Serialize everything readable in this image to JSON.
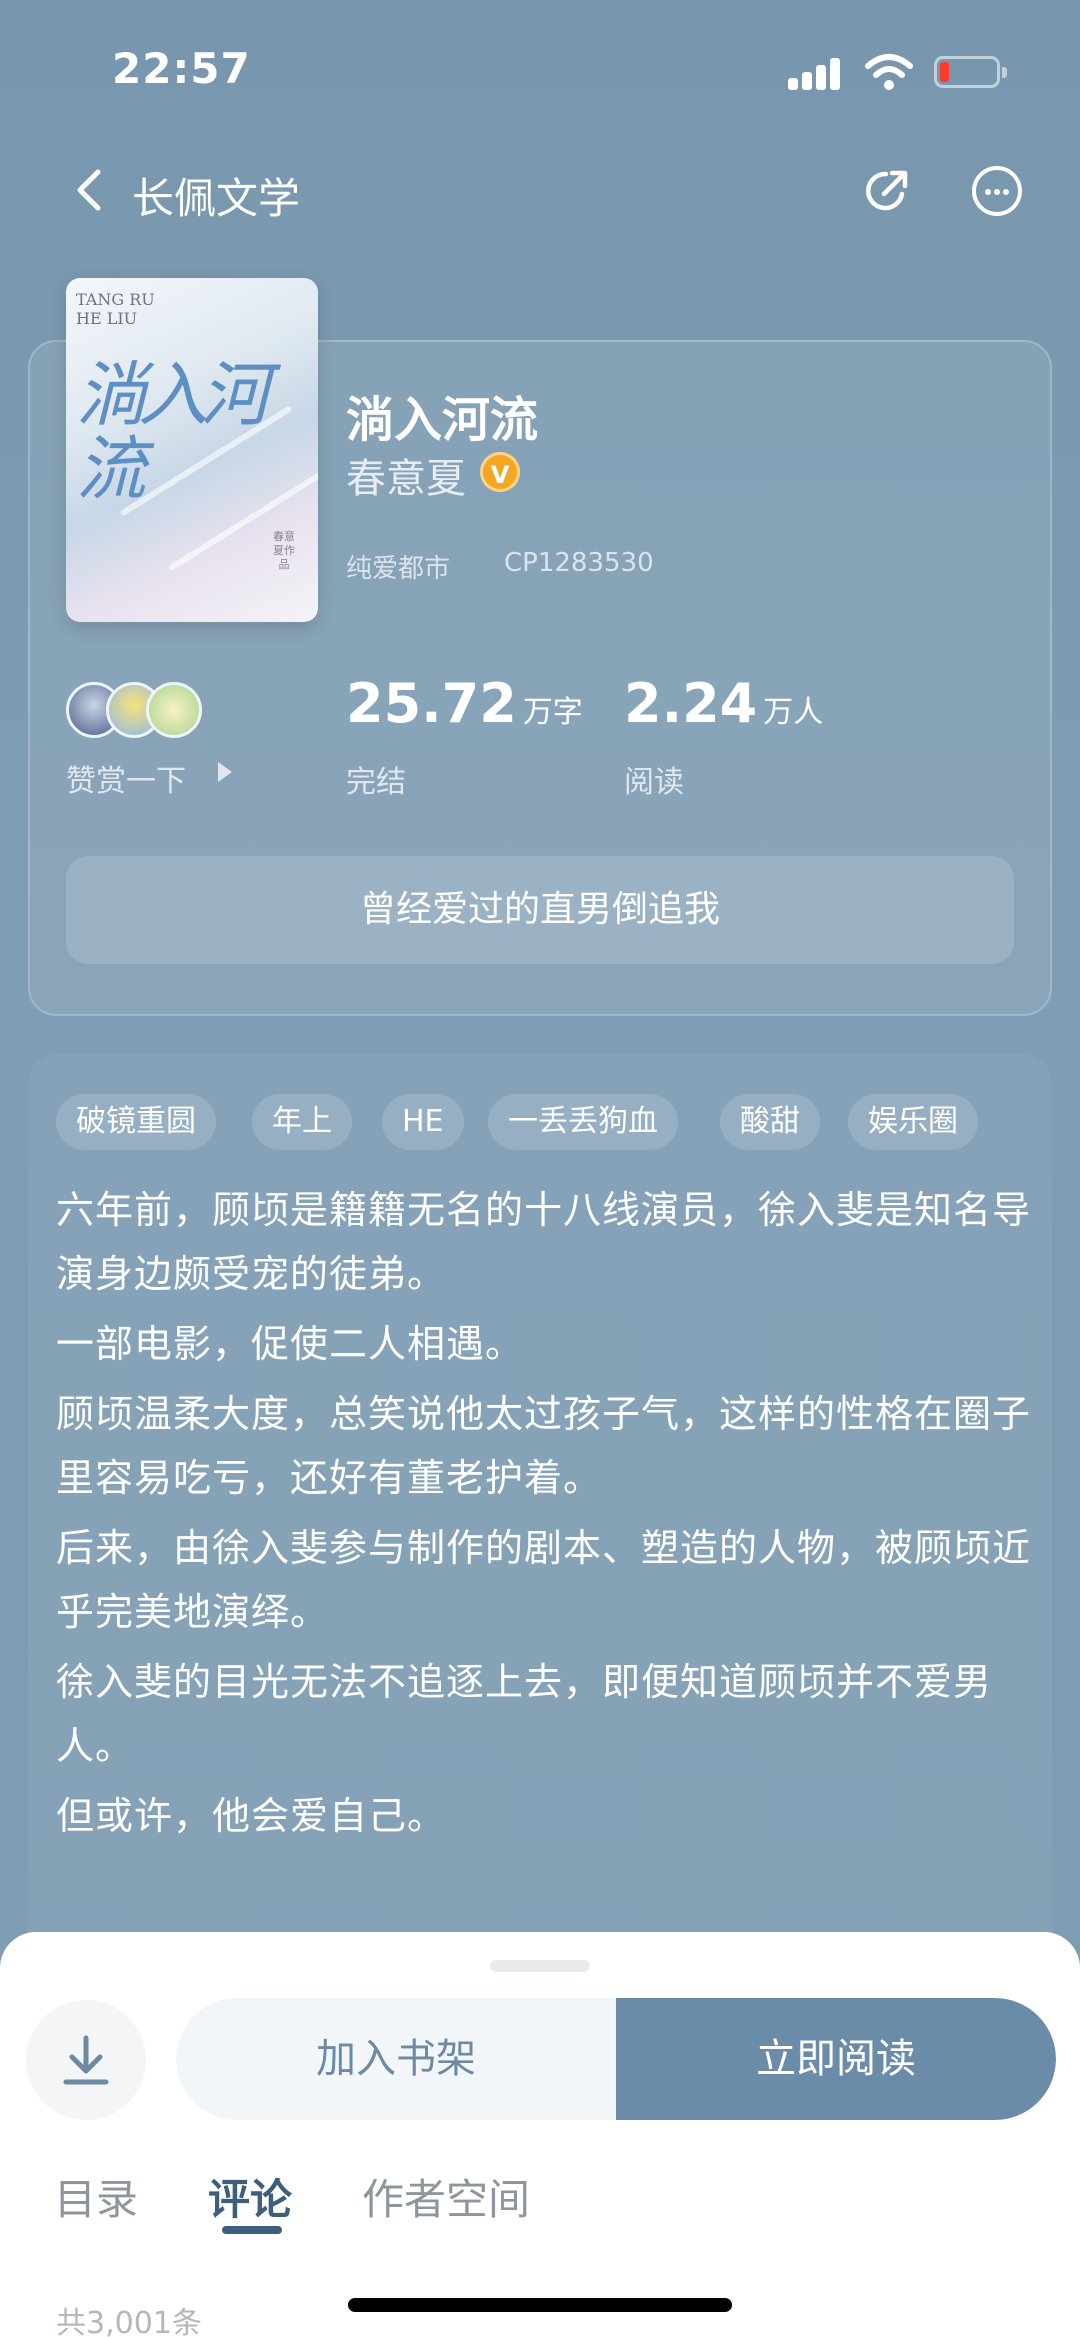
{
  "status": {
    "time": "22:57",
    "battery_color": "#ff3b30"
  },
  "nav": {
    "title": "长佩文学",
    "back_icon": "chevron-left-icon",
    "share_icon": "share-icon",
    "more_icon": "more-icon"
  },
  "book": {
    "cover": {
      "en_line1": "TANG RU",
      "en_line2": "HE LIU",
      "title_art": "淌入河流",
      "author_art": "春意夏作品"
    },
    "title": "淌入河流",
    "author": "春意夏",
    "badge": "V",
    "category": "纯爱都市",
    "code": "CP1283530",
    "reward_label": "赞赏一下",
    "words_value": "25.72",
    "words_unit": "万字",
    "words_label": "完结",
    "reads_value": "2.24",
    "reads_unit": "万人",
    "reads_label": "阅读",
    "slogan": "曾经爱过的直男倒追我"
  },
  "tags": [
    "破镜重圆",
    "年上",
    "HE",
    "一丢丢狗血",
    "酸甜",
    "娱乐圈"
  ],
  "synopsis": [
    "六年前，顾顷是籍籍无名的十八线演员，徐入斐是知名导演身边颇受宠的徒弟。",
    "一部电影，促使二人相遇。",
    "顾顷温柔大度，总笑说他太过孩子气，这样的性格在圈子里容易吃亏，还好有董老护着。",
    "后来，由徐入斐参与制作的剧本、塑造的人物，被顾顷近乎完美地演绎。",
    "徐入斐的目光无法不追逐上去，即便知道顾顷并不爱男人。",
    "但或许，他会爱自己。"
  ],
  "actions": {
    "add_shelf": "加入书架",
    "read_now": "立即阅读",
    "download_icon": "download-icon"
  },
  "tabs": [
    "目录",
    "评论",
    "作者空间"
  ],
  "active_tab": "评论",
  "comments_total": "共3,001条",
  "colors": {
    "accent": "#6b8ca8",
    "active_tab": "#3d5f7c",
    "badge": "#f5a623"
  }
}
